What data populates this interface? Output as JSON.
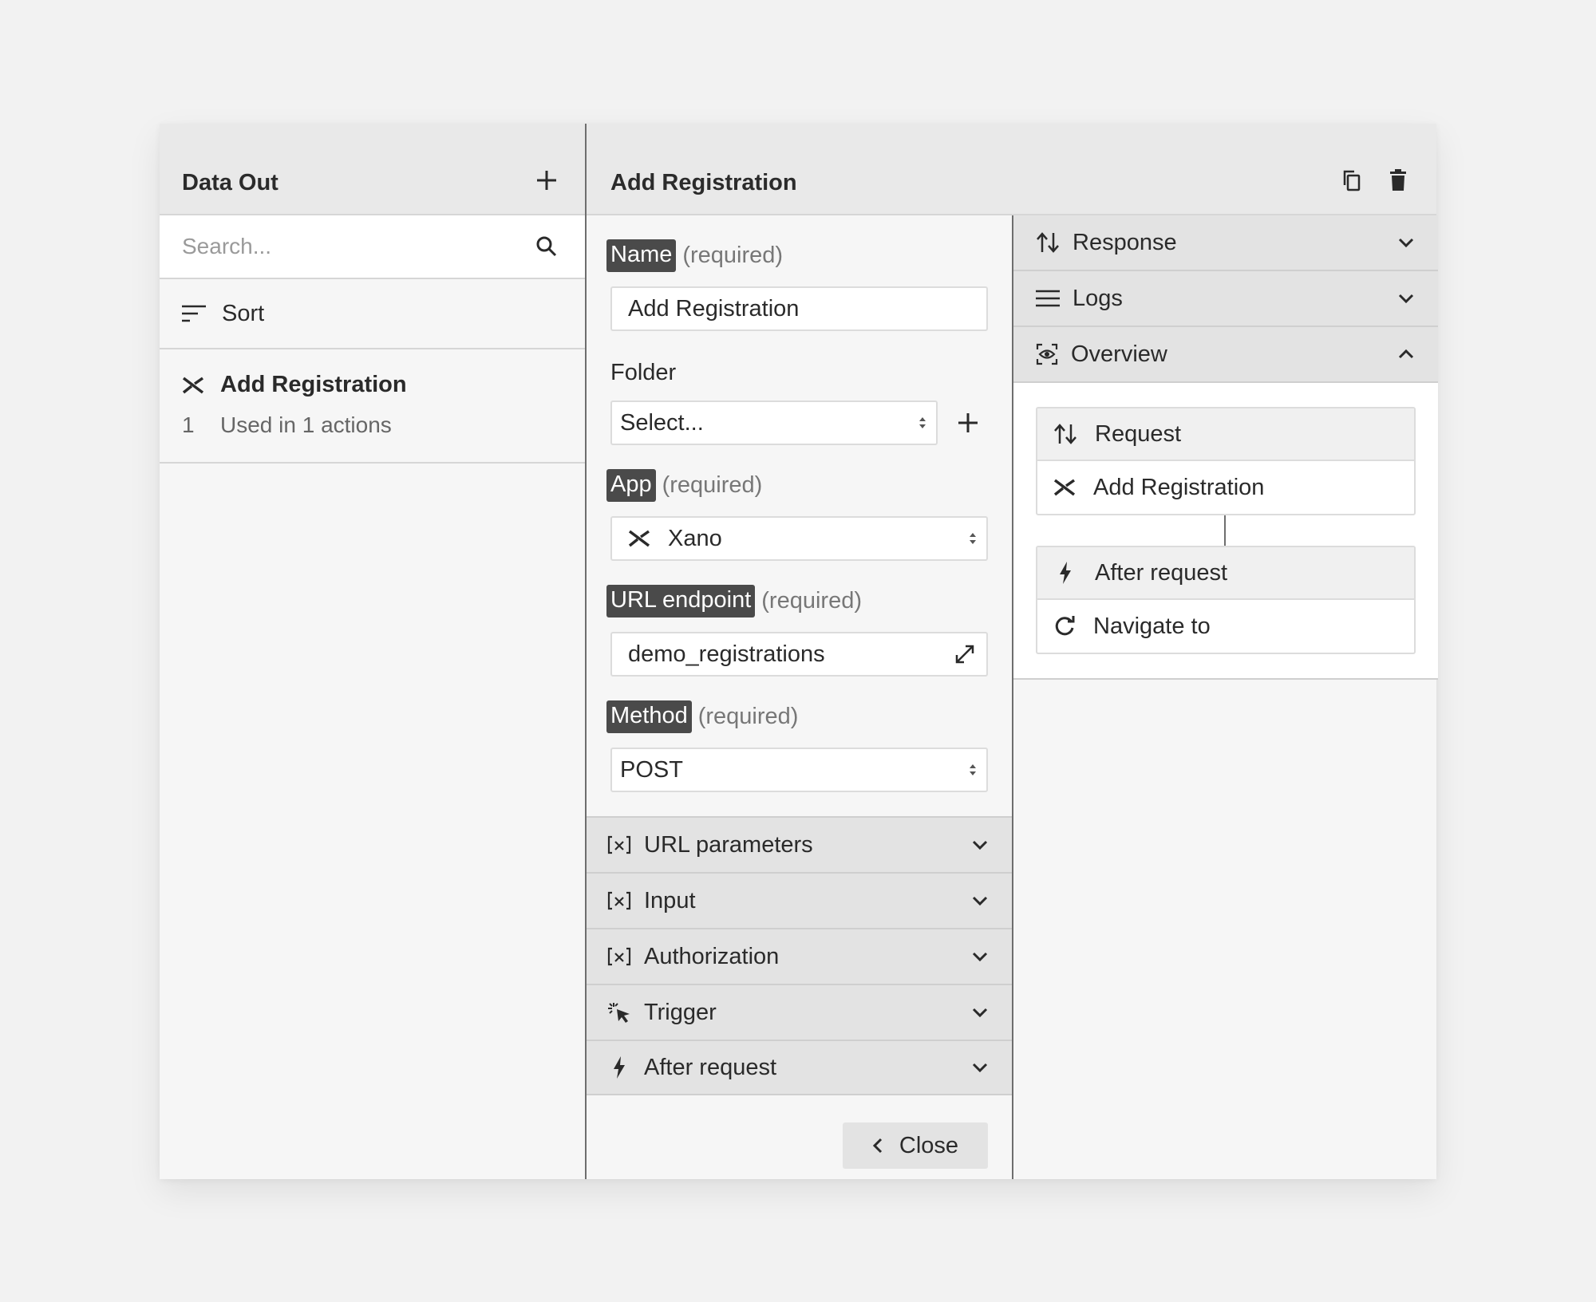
{
  "left_panel": {
    "title": "Data Out",
    "search_placeholder": "Search...",
    "sort_label": "Sort",
    "items": [
      {
        "name": "Add Registration",
        "count": "1",
        "usage": "Used in 1 actions"
      }
    ]
  },
  "main": {
    "title": "Add Registration",
    "name_label": "Name",
    "name_req": "(required)",
    "name_value": "Add Registration",
    "folder_label": "Folder",
    "folder_value": "Select...",
    "app_label": "App",
    "app_req": "(required)",
    "app_value": "Xano",
    "url_label": "URL endpoint",
    "url_req": "(required)",
    "url_value": "demo_registrations",
    "method_label": "Method",
    "method_req": "(required)",
    "method_value": "POST",
    "sections": [
      "URL parameters",
      "Input",
      "Authorization",
      "Trigger",
      "After request"
    ],
    "close_label": "Close"
  },
  "right_panel": {
    "response_label": "Response",
    "logs_label": "Logs",
    "overview_label": "Overview",
    "flow": {
      "request_label": "Request",
      "request_action": "Add Registration",
      "after_label": "After request",
      "after_action": "Navigate to"
    }
  }
}
